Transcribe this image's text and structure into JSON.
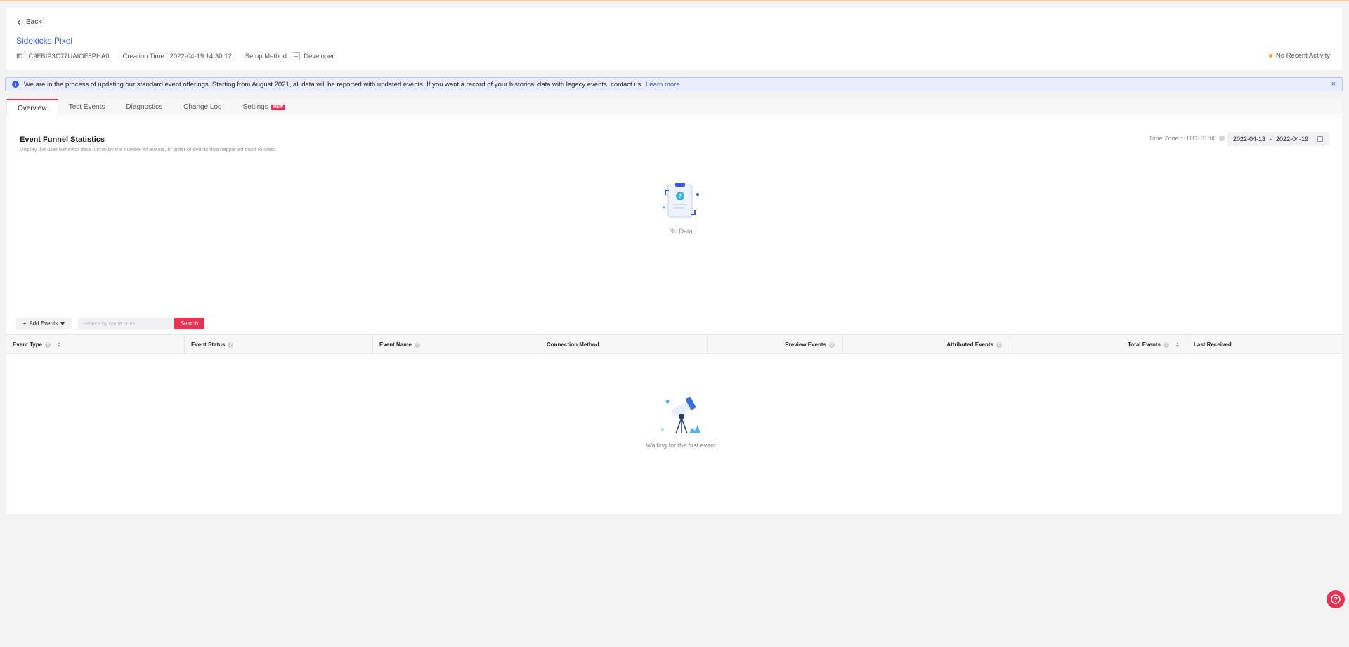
{
  "header": {
    "back_label": "Back",
    "pixel_name": "Sidekicks Pixel",
    "id_text": "ID : C9FBIP3C77UAIOF8PHA0",
    "creation_text": "Creation Time : 2022-04-19 14:30:12",
    "setup_label": "Setup Method :",
    "setup_value": "Developer",
    "activity_status": "No Recent Activity"
  },
  "notice": {
    "text": "We are in the process of updating our standard event offerings. Starting from August 2021, all data will be reported with updated events. If you want a record of your historical data with legacy events, contact us.",
    "link_label": "Learn more",
    "close_symbol": "×"
  },
  "tabs": [
    {
      "label": "Overview",
      "active": true
    },
    {
      "label": "Test Events"
    },
    {
      "label": "Diagnostics"
    },
    {
      "label": "Change Log"
    },
    {
      "label": "Settings",
      "badge": "NEW"
    }
  ],
  "funnel": {
    "title": "Event Funnel Statistics",
    "description": "Display the user behavior data funnel by the number of events, in order of events that happened most to least.",
    "timezone": "Time Zone : UTC+01:00",
    "date_start": "2022-04-13",
    "date_sep": "-",
    "date_end": "2022-04-19",
    "no_data": "No Data"
  },
  "toolbar": {
    "add_events_label": "Add Events",
    "search_placeholder": "Search by name or ID",
    "search_label": "Search"
  },
  "table": {
    "columns": [
      "Event Type",
      "Event Status",
      "Event Name",
      "Connection Method",
      "Preview Events",
      "Attributed Events",
      "Total Events",
      "Last Received"
    ],
    "empty_text": "Waiting for the first event"
  },
  "colors": {
    "accent": "#e63553",
    "link": "#3b5bdb",
    "activity_dot": "#f59a33"
  }
}
